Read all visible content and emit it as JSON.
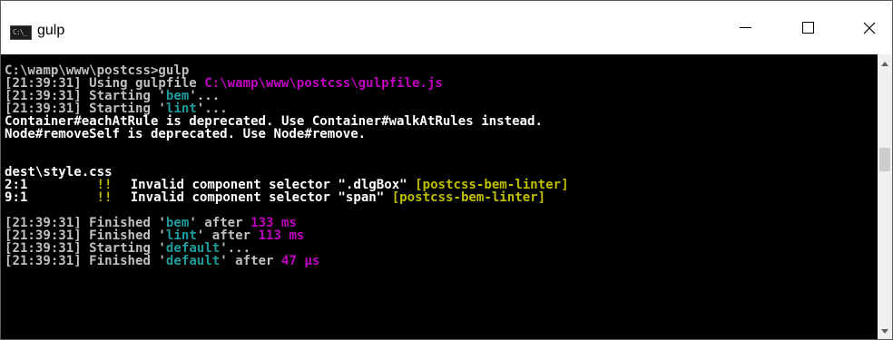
{
  "window": {
    "title": "gulp",
    "icon_text": "C:\\_"
  },
  "controls": {
    "minimize": "minimize",
    "maximize": "maximize",
    "close": "×"
  },
  "console": {
    "l1": {
      "t": "C:\\wamp\\www\\postcss>gulp"
    },
    "l2": {
      "a": "[21:39:31] Using gulpfile ",
      "b": "C:\\wamp\\www\\postcss\\gulpfile.js"
    },
    "l3": {
      "a": "[21:39:31] Starting '",
      "b": "bem",
      "c": "'..."
    },
    "l4": {
      "a": "[21:39:31] Starting '",
      "b": "lint",
      "c": "'..."
    },
    "l5": {
      "t": "Container#eachAtRule is deprecated. Use Container#walkAtRules instead."
    },
    "l6": {
      "t": "Node#removeSelf is deprecated. Use Node#remove."
    },
    "l7": {
      "t": "dest\\style.css"
    },
    "l8": {
      "a": "2:1",
      "b": "!!",
      "c": "Invalid component selector \".dlgBox\" ",
      "d": "[postcss-bem-linter]"
    },
    "l9": {
      "a": "9:1",
      "b": "!!",
      "c": "Invalid component selector \"span\" ",
      "d": "[postcss-bem-linter]"
    },
    "l10": {
      "a": "[21:39:31] Finished '",
      "b": "bem",
      "c": "' after ",
      "d": "133 ms"
    },
    "l11": {
      "a": "[21:39:31] Finished '",
      "b": "lint",
      "c": "' after ",
      "d": "113 ms"
    },
    "l12": {
      "a": "[21:39:31] Starting '",
      "b": "default",
      "c": "'..."
    },
    "l13": {
      "a": "[21:39:31] Finished '",
      "b": "default",
      "c": "' after ",
      "d": "47 μs"
    }
  },
  "colors": {
    "background": "#000000",
    "text": "#c0c0c0",
    "path": "#c000c0",
    "task": "#1e9c9c",
    "warning": "#bfbf00"
  }
}
